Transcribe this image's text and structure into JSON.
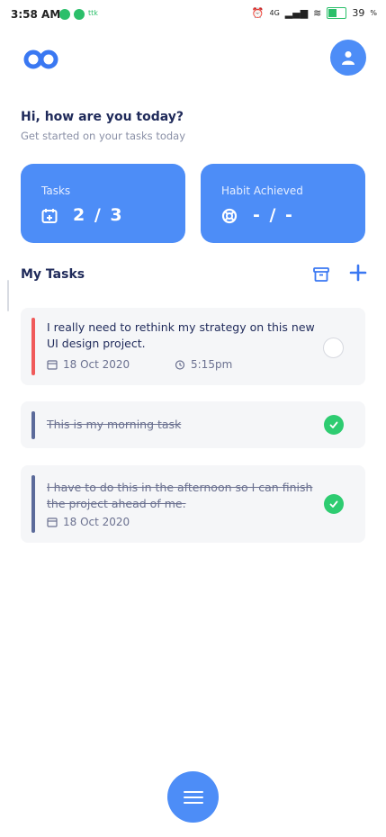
{
  "status_bar": {
    "time": "3:58 AM",
    "small_text": "ttk",
    "network": "4G",
    "battery": "39"
  },
  "header": {
    "greeting": "Hi, how are you today?",
    "subtitle": "Get started on your tasks today"
  },
  "cards": [
    {
      "label": "Tasks",
      "value": "2 / 3",
      "icon": "calendar-plus-icon"
    },
    {
      "label": "Habit Achieved",
      "value": "- / -",
      "icon": "lifebuoy-icon"
    }
  ],
  "section": {
    "title": "My Tasks"
  },
  "tasks": [
    {
      "text": "I really need to rethink my strategy on this new UI design project.",
      "date": "18 Oct 2020",
      "time": "5:15pm",
      "done": false,
      "color": "#f05a5a"
    },
    {
      "text": "This is my morning task",
      "done": true,
      "color": "#5b6a9a"
    },
    {
      "text": "I have to do this in the afternoon so I can finish the project ahead of me.",
      "date": "18 Oct 2020",
      "done": true,
      "color": "#5b6a9a"
    }
  ],
  "colors": {
    "accent": "#4d8df7",
    "success": "#2ecc71",
    "danger": "#f05a5a"
  }
}
